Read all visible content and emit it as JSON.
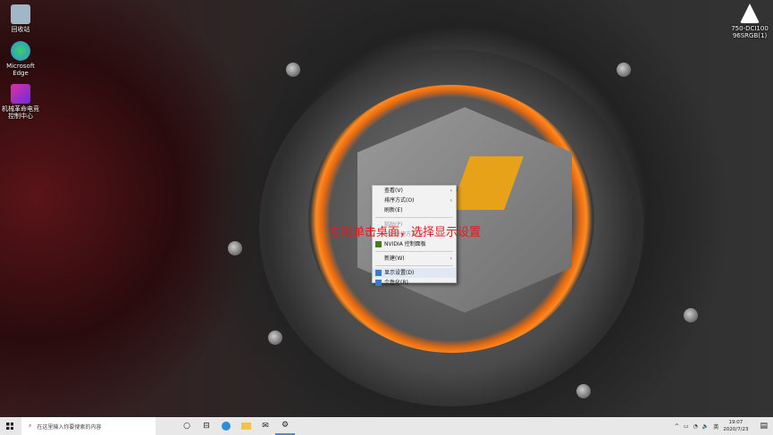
{
  "desktop_icons": [
    {
      "label": "回收站",
      "color": "#9fb8c8"
    },
    {
      "label": "Microsoft Edge",
      "color": "#2a8fd8"
    },
    {
      "label": "机械革命电竞控制中心",
      "color": "#9a2ee0"
    },
    {
      "label": "750-DCI100 96SRGB(1)",
      "color": "#ffffff"
    }
  ],
  "context_menu": {
    "items": [
      {
        "label": "查看(V)",
        "submenu": true
      },
      {
        "label": "排序方式(O)",
        "submenu": true
      },
      {
        "label": "刷新(E)"
      },
      {
        "label": "粘贴(P)",
        "disabled": true
      },
      {
        "label": "粘贴快捷方式(S)",
        "disabled": true
      },
      {
        "label": "NVIDIA 控制面板"
      },
      {
        "label": "新建(W)",
        "submenu": true
      },
      {
        "label": "显示设置(D)",
        "highlighted": true
      },
      {
        "label": "个性化(R)"
      }
    ]
  },
  "annotation": "右键单击桌面，选择显示设置",
  "annotation_color": "#e8191e",
  "taskbar": {
    "search_placeholder": "在这里输入你要搜索的内容",
    "ime": "英",
    "time": "19:07",
    "date": "2020/7/23"
  }
}
